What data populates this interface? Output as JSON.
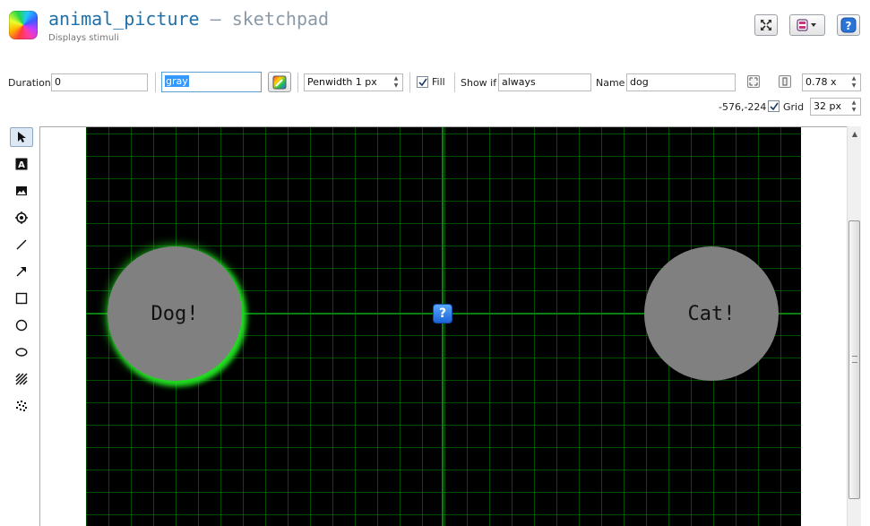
{
  "header": {
    "item_name": "animal_picture",
    "separator": " — ",
    "item_type": "sketchpad",
    "subtitle": "Displays stimuli",
    "fullscreen_icon": "fullscreen-icon",
    "options_icon": "options-menu-icon",
    "help_icon": "help-icon"
  },
  "toolbar": {
    "duration_label": "Duration",
    "duration_value": "0",
    "color_value": "gray",
    "penwidth_value": "Penwidth 1 px",
    "fill_label": "Fill",
    "fill_checked": true,
    "showif_label": "Show if",
    "showif_value": "always",
    "name_label": "Name",
    "name_value": "dog",
    "zoom_value": "0.78 x",
    "coords": "-576,-224",
    "grid_label": "Grid",
    "grid_checked": true,
    "grid_value": "32 px"
  },
  "tools": [
    {
      "name": "pointer",
      "icon": "pointer-icon"
    },
    {
      "name": "text",
      "icon": "text-icon"
    },
    {
      "name": "image",
      "icon": "image-icon"
    },
    {
      "name": "fixdot",
      "icon": "fixation-dot-icon"
    },
    {
      "name": "line",
      "icon": "line-icon"
    },
    {
      "name": "arrow",
      "icon": "arrow-icon"
    },
    {
      "name": "rect",
      "icon": "rectangle-icon"
    },
    {
      "name": "circle",
      "icon": "circle-icon"
    },
    {
      "name": "ellipse",
      "icon": "ellipse-icon"
    },
    {
      "name": "gabor",
      "icon": "gabor-icon"
    },
    {
      "name": "noise",
      "icon": "noise-patch-icon"
    }
  ],
  "canvas": {
    "background": "#000000",
    "grid_color": "#0a7f10",
    "selection_glow": "#22dd22",
    "objects": [
      {
        "type": "circle",
        "label": "Dog!",
        "fill": "#808080",
        "selected": true
      },
      {
        "type": "circle",
        "label": "Cat!",
        "fill": "#808080",
        "selected": false
      }
    ],
    "center_marker": "?"
  }
}
